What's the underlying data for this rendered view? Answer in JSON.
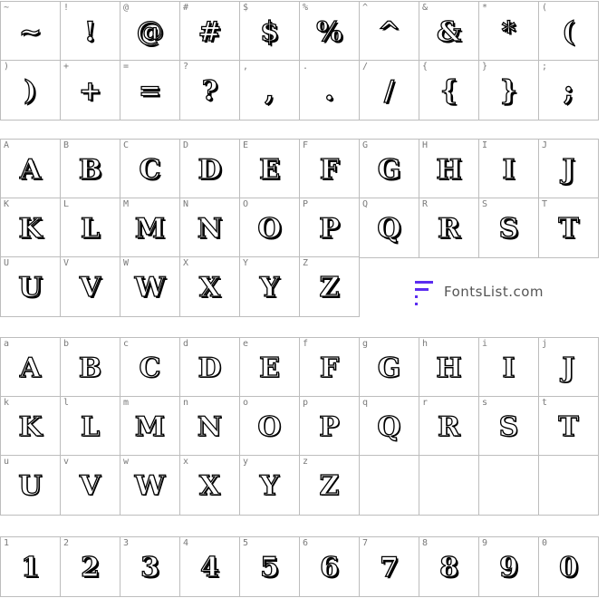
{
  "symbols": [
    [
      {
        "label": "~",
        "glyph": "~"
      },
      {
        "label": "!",
        "glyph": "!"
      },
      {
        "label": "@",
        "glyph": "@"
      },
      {
        "label": "#",
        "glyph": "#"
      },
      {
        "label": "$",
        "glyph": "$"
      },
      {
        "label": "%",
        "glyph": "%"
      },
      {
        "label": "^",
        "glyph": "^"
      },
      {
        "label": "&",
        "glyph": "&"
      },
      {
        "label": "*",
        "glyph": "*"
      },
      {
        "label": "(",
        "glyph": "("
      }
    ],
    [
      {
        "label": ")",
        "glyph": ")"
      },
      {
        "label": "+",
        "glyph": "+"
      },
      {
        "label": "=",
        "glyph": "="
      },
      {
        "label": "?",
        "glyph": "?"
      },
      {
        "label": ",",
        "glyph": ","
      },
      {
        "label": ".",
        "glyph": "."
      },
      {
        "label": "/",
        "glyph": "/"
      },
      {
        "label": "{",
        "glyph": "{"
      },
      {
        "label": "}",
        "glyph": "}"
      },
      {
        "label": ";",
        "glyph": ";"
      }
    ]
  ],
  "uppercase": [
    [
      {
        "label": "A",
        "glyph": "A"
      },
      {
        "label": "B",
        "glyph": "B"
      },
      {
        "label": "C",
        "glyph": "C"
      },
      {
        "label": "D",
        "glyph": "D"
      },
      {
        "label": "E",
        "glyph": "E"
      },
      {
        "label": "F",
        "glyph": "F"
      },
      {
        "label": "G",
        "glyph": "G"
      },
      {
        "label": "H",
        "glyph": "H"
      },
      {
        "label": "I",
        "glyph": "I"
      },
      {
        "label": "J",
        "glyph": "J"
      }
    ],
    [
      {
        "label": "K",
        "glyph": "K"
      },
      {
        "label": "L",
        "glyph": "L"
      },
      {
        "label": "M",
        "glyph": "M"
      },
      {
        "label": "N",
        "glyph": "N"
      },
      {
        "label": "O",
        "glyph": "O"
      },
      {
        "label": "P",
        "glyph": "P"
      },
      {
        "label": "Q",
        "glyph": "Q"
      },
      {
        "label": "R",
        "glyph": "R"
      },
      {
        "label": "S",
        "glyph": "S"
      },
      {
        "label": "T",
        "glyph": "T"
      }
    ],
    [
      {
        "label": "U",
        "glyph": "U"
      },
      {
        "label": "V",
        "glyph": "V"
      },
      {
        "label": "W",
        "glyph": "W"
      },
      {
        "label": "X",
        "glyph": "X"
      },
      {
        "label": "Y",
        "glyph": "Y"
      },
      {
        "label": "Z",
        "glyph": "Z"
      }
    ]
  ],
  "lowercase": [
    [
      {
        "label": "a",
        "glyph": "A"
      },
      {
        "label": "b",
        "glyph": "B"
      },
      {
        "label": "c",
        "glyph": "C"
      },
      {
        "label": "d",
        "glyph": "D"
      },
      {
        "label": "e",
        "glyph": "E"
      },
      {
        "label": "f",
        "glyph": "F"
      },
      {
        "label": "g",
        "glyph": "G"
      },
      {
        "label": "h",
        "glyph": "H"
      },
      {
        "label": "i",
        "glyph": "I"
      },
      {
        "label": "j",
        "glyph": "J"
      }
    ],
    [
      {
        "label": "k",
        "glyph": "K"
      },
      {
        "label": "l",
        "glyph": "L"
      },
      {
        "label": "m",
        "glyph": "M"
      },
      {
        "label": "n",
        "glyph": "N"
      },
      {
        "label": "o",
        "glyph": "O"
      },
      {
        "label": "p",
        "glyph": "P"
      },
      {
        "label": "q",
        "glyph": "Q"
      },
      {
        "label": "r",
        "glyph": "R"
      },
      {
        "label": "s",
        "glyph": "S"
      },
      {
        "label": "t",
        "glyph": "T"
      }
    ],
    [
      {
        "label": "u",
        "glyph": "U"
      },
      {
        "label": "v",
        "glyph": "V"
      },
      {
        "label": "w",
        "glyph": "W"
      },
      {
        "label": "x",
        "glyph": "X"
      },
      {
        "label": "y",
        "glyph": "Y"
      },
      {
        "label": "z",
        "glyph": "Z"
      },
      {
        "label": "",
        "glyph": ""
      },
      {
        "label": "",
        "glyph": ""
      },
      {
        "label": "",
        "glyph": ""
      },
      {
        "label": "",
        "glyph": ""
      }
    ]
  ],
  "digits": [
    [
      {
        "label": "1",
        "glyph": "1"
      },
      {
        "label": "2",
        "glyph": "2"
      },
      {
        "label": "3",
        "glyph": "3"
      },
      {
        "label": "4",
        "glyph": "4"
      },
      {
        "label": "5",
        "glyph": "5"
      },
      {
        "label": "6",
        "glyph": "6"
      },
      {
        "label": "7",
        "glyph": "7"
      },
      {
        "label": "8",
        "glyph": "8"
      },
      {
        "label": "9",
        "glyph": "9"
      },
      {
        "label": "0",
        "glyph": "0"
      }
    ]
  ],
  "watermark": {
    "text": "FontsList.com",
    "icon": "fontslist-logo-icon",
    "accent": "#5b2cf0"
  }
}
